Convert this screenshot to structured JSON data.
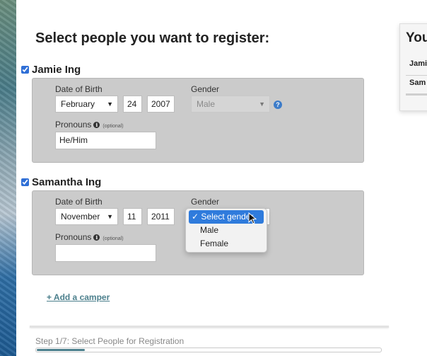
{
  "heading": "Select people you want to register:",
  "people": [
    {
      "name": "Jamie Ing",
      "checked": true,
      "dob_label": "Date of Birth",
      "month": "February",
      "day": "24",
      "year": "2007",
      "gender_label": "Gender",
      "gender": "Male",
      "gender_help": "?",
      "pronouns_label": "Pronouns",
      "pronouns_optional": "(optional)",
      "pronouns_value": "He/Him"
    },
    {
      "name": "Samantha Ing",
      "checked": true,
      "dob_label": "Date of Birth",
      "month": "November",
      "day": "11",
      "year": "2011",
      "gender_label": "Gender",
      "pronouns_label": "Pronouns",
      "pronouns_optional": "(optional)",
      "pronouns_value": ""
    }
  ],
  "gender_dropdown": {
    "check_mark": "✓",
    "options": [
      "Select gender",
      "Male",
      "Female"
    ],
    "highlighted": "Select gender"
  },
  "add_camper": "+ Add a camper",
  "step_text": "Step 1/7: Select People for Registration",
  "progress_fraction": 0.14,
  "side_panel": {
    "title": "You",
    "rows": [
      "Jami",
      "Sam"
    ]
  },
  "icons": {
    "info": "info-icon",
    "help": "help-icon",
    "chevron": "chevron-down-icon",
    "cursor": "mouse-pointer-icon"
  },
  "colors": {
    "accent_link": "#4b7f8c",
    "select_highlight": "#2f7bdc",
    "panel_bg": "#cbcbcb"
  }
}
